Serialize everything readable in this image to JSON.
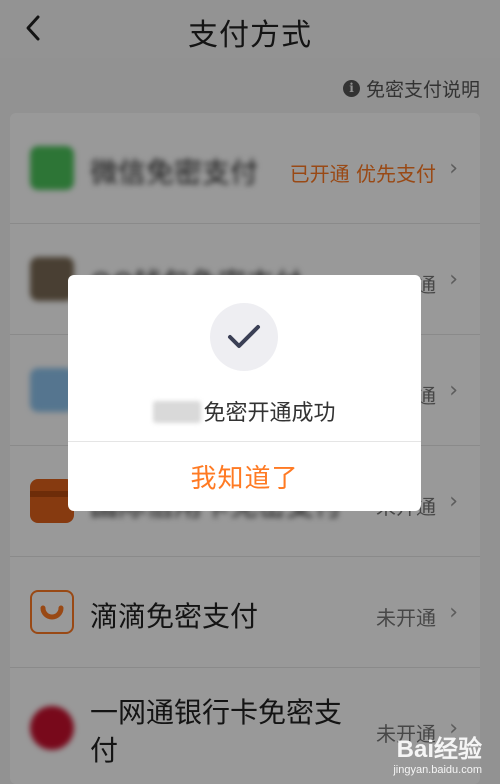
{
  "header": {
    "title": "支付方式",
    "back_icon": "chevron-left-icon"
  },
  "info": {
    "label": "免密支付说明",
    "icon_glyph": "i"
  },
  "rows": [
    {
      "label": "微信免密支付",
      "status": "已开通 优先支付",
      "status_color": "#ff7a23",
      "chevron": "›",
      "icon": "wechat-icon"
    },
    {
      "label": "QQ钱包免密支付",
      "status": "未开通",
      "chevron": "›",
      "icon": "qq-icon"
    },
    {
      "label": "",
      "status": "未开通",
      "chevron": "›",
      "icon": "app-icon"
    },
    {
      "label": "国际信用卡免密支付",
      "status": "未开通",
      "chevron": "›",
      "icon": "card-icon"
    },
    {
      "label": "滴滴免密支付",
      "status": "未开通",
      "chevron": "›",
      "icon": "didi-icon"
    },
    {
      "label": "一网通银行卡免密支付",
      "status": "未开通",
      "chevron": "›",
      "icon": "cmb-icon"
    }
  ],
  "dialog": {
    "icon": "check-icon",
    "message": "免密开通成功",
    "button": "我知道了"
  },
  "watermark": {
    "brand": "Bai经验",
    "url": "jingyan.baidu.com"
  },
  "colors": {
    "accent": "#ff7a23",
    "overlay": "rgba(0,0,0,0.40)"
  }
}
